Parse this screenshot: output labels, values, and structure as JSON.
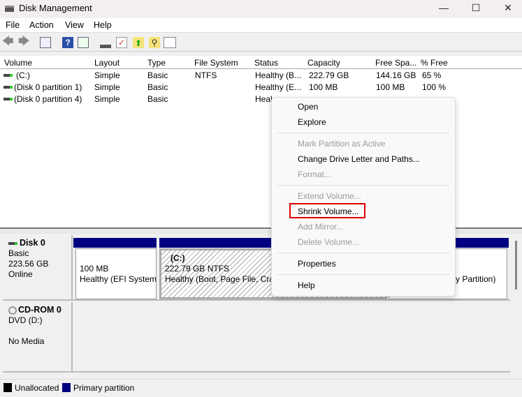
{
  "window": {
    "title": "Disk Management",
    "controls": [
      "minimize",
      "maximize",
      "close"
    ]
  },
  "menubar": [
    "File",
    "Action",
    "View",
    "Help"
  ],
  "toolbar": [
    "back-icon",
    "forward-icon",
    "console-tree-icon",
    "help-icon",
    "action-pane-icon",
    "connect-icon",
    "check-icon",
    "up-icon",
    "search-icon",
    "properties-icon"
  ],
  "table": {
    "columns": [
      "Volume",
      "Layout",
      "Type",
      "File System",
      "Status",
      "Capacity",
      "Free Spa...",
      "% Free"
    ],
    "rows": [
      [
        "(C:)",
        "Simple",
        "Basic",
        "NTFS",
        "Healthy (B...",
        "222.79 GB",
        "144.16 GB",
        "65 %"
      ],
      [
        "(Disk 0 partition 1)",
        "Simple",
        "Basic",
        "",
        "Healthy (E...",
        "100 MB",
        "100 MB",
        "100 %"
      ],
      [
        "(Disk 0 partition 4)",
        "Simple",
        "Basic",
        "",
        "Heal",
        "",
        "",
        ""
      ]
    ]
  },
  "context_menu": {
    "items": [
      {
        "label": "Open",
        "enabled": true
      },
      {
        "label": "Explore",
        "enabled": true
      },
      {
        "label": "Mark Partition as Active",
        "enabled": false
      },
      {
        "label": "Change Drive Letter and Paths...",
        "enabled": true
      },
      {
        "label": "Format...",
        "enabled": false
      },
      {
        "label": "Extend Volume...",
        "enabled": false
      },
      {
        "label": "Shrink Volume...",
        "enabled": true,
        "highlighted": true
      },
      {
        "label": "Add Mirror...",
        "enabled": false
      },
      {
        "label": "Delete Volume...",
        "enabled": false
      },
      {
        "label": "Properties",
        "enabled": true
      },
      {
        "label": "Help",
        "enabled": true
      }
    ],
    "highlight_color": "#e00000"
  },
  "disks": [
    {
      "name": "Disk 0",
      "type": "Basic",
      "size": "223.56 GB",
      "status": "Online",
      "partitions": [
        {
          "size": "100 MB",
          "status": "Healthy (EFI System"
        },
        {
          "label": "(C:)",
          "size": "222.79 GB NTFS",
          "status": "Healthy (Boot, Page File, Cras"
        },
        {
          "status": "y Partition)"
        }
      ]
    },
    {
      "name": "CD-ROM 0",
      "type": "DVD (D:)",
      "status": "No Media"
    }
  ],
  "legend": [
    {
      "label": "Unallocated",
      "color": "#000000"
    },
    {
      "label": "Primary partition",
      "color": "#000080"
    }
  ]
}
